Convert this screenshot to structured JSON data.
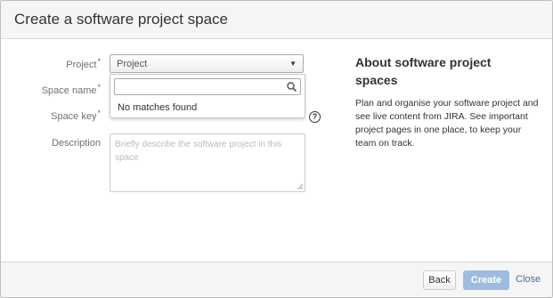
{
  "dialog": {
    "title": "Create a software project space"
  },
  "form": {
    "project_label": "Project",
    "project_value": "Project",
    "space_name_label": "Space name",
    "space_key_label": "Space key",
    "description_label": "Description",
    "description_placeholder": "Briefly describe the software project in this space",
    "required_marker": "*",
    "help_glyph": "?"
  },
  "dropdown": {
    "search_value": "",
    "no_matches": "No matches found"
  },
  "about": {
    "title": "About software project spaces",
    "text": "Plan and organise your software project and see live content from JIRA. See important project pages in one place, to keep your team on track."
  },
  "footer": {
    "back_label": "Back",
    "create_label": "Create",
    "close_label": "Close"
  },
  "colors": {
    "accent": "#3b73af",
    "required": "#d04437",
    "create_disabled": "#9dbde0"
  },
  "icons": {
    "search": "search-icon",
    "help": "help-icon",
    "caret": "chevron-down-icon"
  }
}
